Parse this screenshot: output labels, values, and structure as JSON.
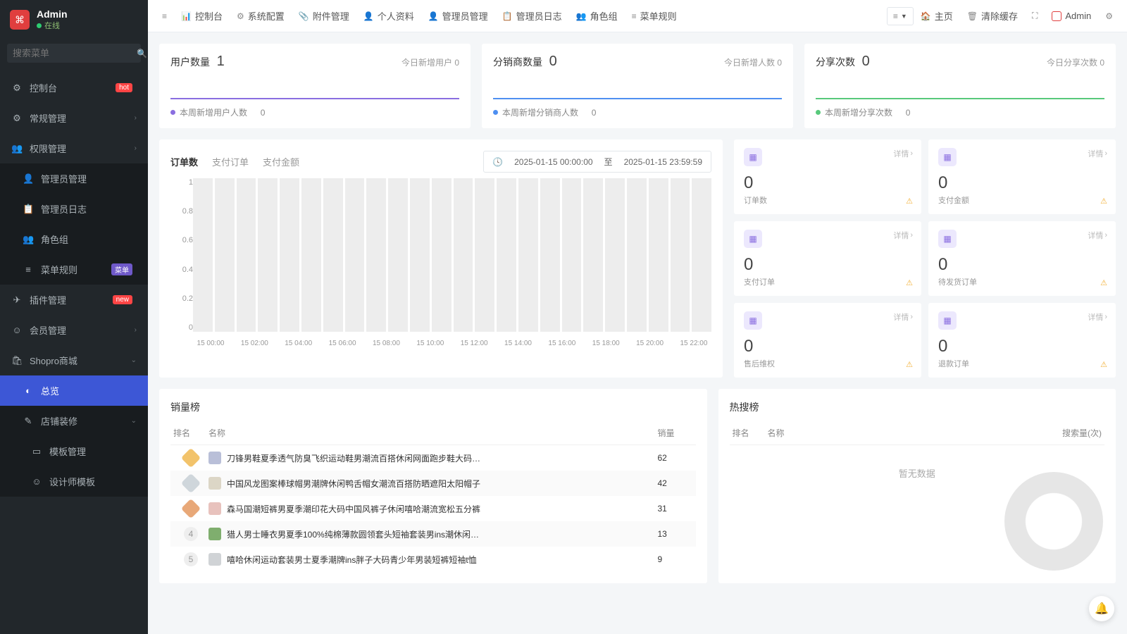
{
  "user": {
    "name": "Admin",
    "status": "在线"
  },
  "search": {
    "placeholder": "搜索菜单"
  },
  "sidebar": [
    {
      "icon": "⚙",
      "label": "控制台",
      "badge": "hot",
      "badgeClass": "badge-hot"
    },
    {
      "icon": "⚙",
      "label": "常规管理",
      "caret": true
    },
    {
      "icon": "👥",
      "label": "权限管理",
      "caret": true,
      "expanded": true,
      "children": [
        {
          "icon": "👤",
          "label": "管理员管理"
        },
        {
          "icon": "📋",
          "label": "管理员日志"
        },
        {
          "icon": "👥",
          "label": "角色组"
        },
        {
          "icon": "≡",
          "label": "菜单规则",
          "badge": "菜单",
          "badgeClass": "badge-menu"
        }
      ]
    },
    {
      "icon": "✈",
      "label": "插件管理",
      "badge": "new",
      "badgeClass": "badge-new"
    },
    {
      "icon": "☺",
      "label": "会员管理",
      "caret": true
    },
    {
      "icon": "🛍",
      "label": "Shopro商城",
      "caret": true,
      "caretDown": true,
      "expanded": true,
      "children": [
        {
          "icon": "◐",
          "label": "总览",
          "active": true
        },
        {
          "icon": "✎",
          "label": "店铺装修",
          "caret": true,
          "caretDown": true,
          "expanded": true,
          "children": [
            {
              "icon": "▭",
              "label": "模板管理"
            },
            {
              "icon": "☺",
              "label": "设计师模板"
            }
          ]
        }
      ]
    }
  ],
  "topbar": {
    "left": [
      {
        "icon": "≡",
        "label": ""
      },
      {
        "icon": "📊",
        "label": "控制台"
      },
      {
        "icon": "⚙",
        "label": "系统配置"
      },
      {
        "icon": "📎",
        "label": "附件管理"
      },
      {
        "icon": "👤",
        "label": "个人资料"
      },
      {
        "icon": "👤",
        "label": "管理员管理"
      },
      {
        "icon": "📋",
        "label": "管理员日志"
      },
      {
        "icon": "👥",
        "label": "角色组"
      },
      {
        "icon": "≡",
        "label": "菜单规则"
      }
    ],
    "right": [
      {
        "icon": "🏠",
        "label": "主页"
      },
      {
        "icon": "🗑",
        "label": "清除缓存"
      },
      {
        "icon": "⛶",
        "label": ""
      },
      {
        "icon": "",
        "label": "Admin",
        "redsq": true
      },
      {
        "icon": "⚙",
        "label": ""
      }
    ]
  },
  "topCards": [
    {
      "title": "用户数量",
      "value": "1",
      "rightLabel": "今日新增用户",
      "rightVal": "0",
      "footLabel": "本周新增用户人数",
      "footVal": "0",
      "color": "purple"
    },
    {
      "title": "分销商数量",
      "value": "0",
      "rightLabel": "今日新增人数",
      "rightVal": "0",
      "footLabel": "本周新增分销商人数",
      "footVal": "0",
      "color": "blue"
    },
    {
      "title": "分享次数",
      "value": "0",
      "rightLabel": "今日分享次数",
      "rightVal": "0",
      "footLabel": "本周新增分享次数",
      "footVal": "0",
      "color": "green"
    }
  ],
  "chart": {
    "tabs": [
      "订单数",
      "支付订单",
      "支付金额"
    ],
    "dateFrom": "2025-01-15 00:00:00",
    "dateSep": "至",
    "dateTo": "2025-01-15 23:59:59"
  },
  "chart_data": {
    "type": "bar",
    "categories": [
      "15 00:00",
      "15 01:00",
      "15 02:00",
      "15 03:00",
      "15 04:00",
      "15 05:00",
      "15 06:00",
      "15 07:00",
      "15 08:00",
      "15 09:00",
      "15 10:00",
      "15 11:00",
      "15 12:00",
      "15 13:00",
      "15 14:00",
      "15 15:00",
      "15 16:00",
      "15 17:00",
      "15 18:00",
      "15 19:00",
      "15 20:00",
      "15 21:00",
      "15 22:00",
      "15 23:00"
    ],
    "values": [
      0,
      0,
      0,
      0,
      0,
      0,
      0,
      0,
      0,
      0,
      0,
      0,
      0,
      0,
      0,
      0,
      0,
      0,
      0,
      0,
      0,
      0,
      0,
      0
    ],
    "yticks": [
      "1",
      "0.8",
      "0.6",
      "0.4",
      "0.2",
      "0"
    ],
    "xticks": [
      "15 00:00",
      "15 02:00",
      "15 04:00",
      "15 06:00",
      "15 08:00",
      "15 10:00",
      "15 12:00",
      "15 14:00",
      "15 16:00",
      "15 18:00",
      "15 20:00",
      "15 22:00"
    ],
    "ylim": [
      0,
      1
    ],
    "title": "订单数",
    "xlabel": "",
    "ylabel": ""
  },
  "stats": [
    {
      "value": "0",
      "label": "订单数"
    },
    {
      "value": "0",
      "label": "支付金额"
    },
    {
      "value": "0",
      "label": "支付订单"
    },
    {
      "value": "0",
      "label": "待发货订单"
    },
    {
      "value": "0",
      "label": "售后维权"
    },
    {
      "value": "0",
      "label": "退款订单"
    }
  ],
  "statDetail": "详情",
  "salesRank": {
    "title": "销量榜",
    "cols": [
      "排名",
      "名称",
      "销量"
    ],
    "rows": [
      {
        "rank": 1,
        "thumb": "#b9bfd8",
        "name": "刀锋男鞋夏季透气防臭飞织运动鞋男潮流百搭休闲网面跑步鞋大码…",
        "val": "62"
      },
      {
        "rank": 2,
        "thumb": "#dcd6c6",
        "name": "中国风龙图案棒球帽男潮牌休闲鸭舌帽女潮流百搭防晒遮阳太阳帽子",
        "val": "42"
      },
      {
        "rank": 3,
        "thumb": "#e8c2bd",
        "name": "森马国潮短裤男夏季潮印花大码中国风裤子休闲嘻哈潮流宽松五分裤",
        "val": "31"
      },
      {
        "rank": 4,
        "thumb": "#7fae6e",
        "name": "猎人男士睡衣男夏季100%纯棉薄款圆领套头短袖套装男ins潮休闲…",
        "val": "13"
      },
      {
        "rank": 5,
        "thumb": "#d0d3d6",
        "name": "嘻哈休闲运动套装男士夏季潮牌ins胖子大码青少年男装短裤短袖t恤",
        "val": "9"
      }
    ]
  },
  "hotRank": {
    "title": "热搜榜",
    "cols": [
      "排名",
      "名称",
      "搜索量(次)"
    ],
    "nodata": "暂无数据"
  }
}
